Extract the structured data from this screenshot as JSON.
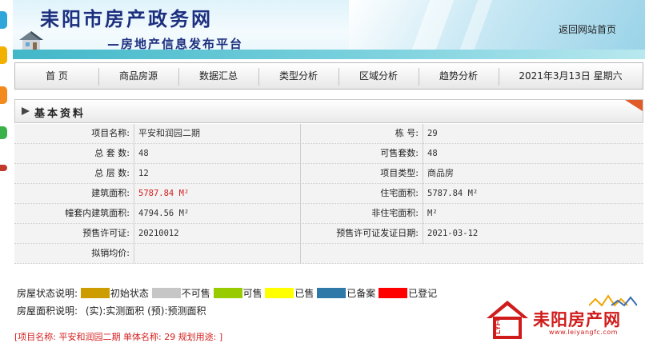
{
  "header": {
    "title": "耒阳市房产政务网",
    "subtitle": "—房地产信息发布平台",
    "home_link": "返回网站首页"
  },
  "nav": {
    "items": [
      "首  页",
      "商品房源",
      "数据汇总",
      "类型分析",
      "区域分析",
      "趋势分析"
    ],
    "date": "2021年3月13日    星期六"
  },
  "panel": {
    "title": "基本资料",
    "left": [
      {
        "label": "项目名称:",
        "value": "平安和润园二期"
      },
      {
        "label": "总 套 数:",
        "value": "48"
      },
      {
        "label": "总 层 数:",
        "value": "12"
      },
      {
        "label": "建筑面积:",
        "value": "5787.84 M²"
      },
      {
        "label": "幢套内建筑面积:",
        "value": "4794.56 M²"
      },
      {
        "label": "预售许可证:",
        "value": "20210012"
      },
      {
        "label": "拟销均价:",
        "value": ""
      }
    ],
    "right": [
      {
        "label": "栋      号:",
        "value": "29"
      },
      {
        "label": "可售套数:",
        "value": "48"
      },
      {
        "label": "项目类型:",
        "value": "商品房"
      },
      {
        "label": "住宅面积:",
        "value": "5787.84 M²"
      },
      {
        "label": "非住宅面积:",
        "value": "M²"
      },
      {
        "label": "预售许可证发证日期:",
        "value": "2021-03-12"
      }
    ]
  },
  "legend": {
    "status_label": "房屋状态说明:",
    "statuses": [
      {
        "label": "初始状态",
        "color": "#cc9c00"
      },
      {
        "label": "不可售",
        "color": "#c6c6c6"
      },
      {
        "label": "可售",
        "color": "#99cc00"
      },
      {
        "label": "已售",
        "color": "#ffff00"
      },
      {
        "label": "已备案",
        "color": "#2e79a8"
      },
      {
        "label": "已登记",
        "color": "#ff0000"
      }
    ],
    "area_label": "房屋面积说明:",
    "area_text": "(实):实测面积  (预):预测面积"
  },
  "bottom_line": "[项目名称: 平安和润园二期   单体名称: 29   规划用途: ]",
  "brand": {
    "badge": "LYFC",
    "name": "耒阳房产网",
    "url": "www.leiyangfc.com"
  },
  "colors": {
    "title": "#1c2f7e",
    "accent_red": "#d42020",
    "header_teal": "#41b7c8"
  }
}
